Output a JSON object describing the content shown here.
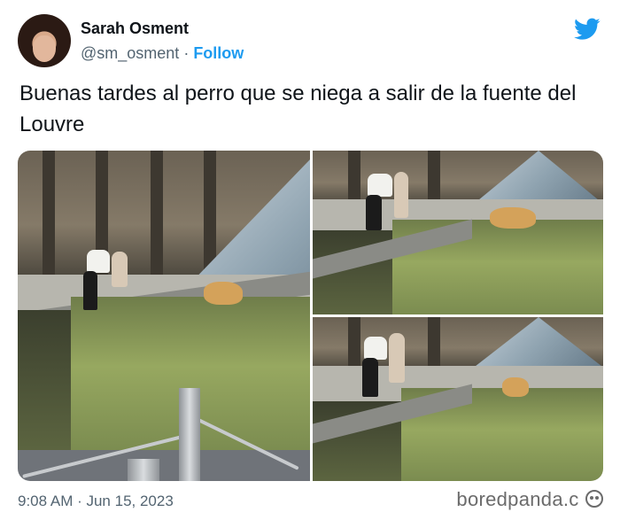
{
  "author": {
    "name": "Sarah Osment",
    "handle": "@sm_osment",
    "separator": " · ",
    "follow_label": "Follow"
  },
  "brand": {
    "icon": "twitter-bird-icon",
    "color": "#1d9bf0"
  },
  "tweet": {
    "text": "Buenas tardes al perro que se niega a salir de la fuente del Louvre"
  },
  "media": {
    "photos": [
      "photo-1",
      "photo-2",
      "photo-3"
    ]
  },
  "footer": {
    "timestamp": "9:08 AM · Jun 15, 2023"
  },
  "watermark": {
    "text": "boredpanda.c",
    "suffix_icon": "bp-logo-icon"
  },
  "colors": {
    "text": "#0f1419",
    "muted": "#536471",
    "accent": "#1d9bf0"
  }
}
